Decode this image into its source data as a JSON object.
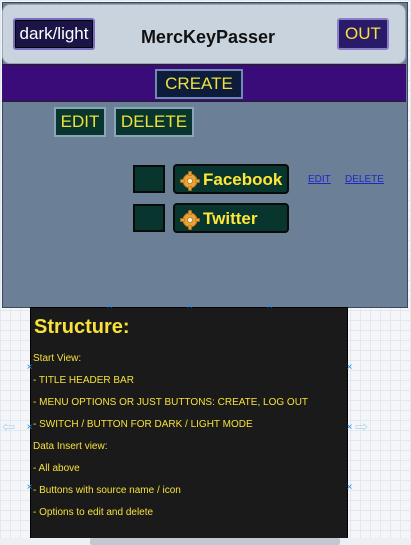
{
  "header": {
    "theme_toggle_label": "dark/light",
    "app_title": "MercKeyPasser",
    "logout_label": "OUT"
  },
  "menu": {
    "create_label": "CREATE"
  },
  "actions": {
    "edit_label": "EDIT",
    "delete_label": "DELETE"
  },
  "sources": [
    {
      "name": "Facebook",
      "icon": "gear-icon",
      "edit_link": "EDIT",
      "delete_link": "DELETE"
    },
    {
      "name": "Twitter",
      "icon": "gear-icon"
    }
  ],
  "structure_note": {
    "title": "Structure:",
    "lines": [
      "Start View:",
      "- TITLE HEADER BAR",
      "- MENU OPTIONS OR JUST BUTTONS: CREATE, LOG OUT",
      "- SWITCH / BUTTON FOR DARK / LIGHT MODE",
      "Data Insert view:",
      "- All above",
      "- Buttons with source name / icon",
      "- Options to edit and delete"
    ]
  },
  "colors": {
    "app_background": "#6b7f96",
    "menu_bar": "#3a0c7a",
    "accent_text": "#f7e13a",
    "button_fill": "#08362f",
    "link": "#1c28c8"
  }
}
